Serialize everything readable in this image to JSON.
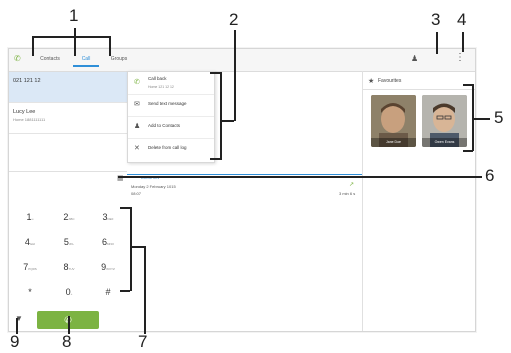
{
  "tabs": [
    {
      "label": "Contacts",
      "active": false
    },
    {
      "label": "Call",
      "active": true
    },
    {
      "label": "Groups",
      "active": false
    }
  ],
  "call_log": [
    {
      "name": "021 121 12",
      "sub": "",
      "time": "3 min ago",
      "selected": true
    },
    {
      "name": "Lucy Lee",
      "sub": "Home 1881111111",
      "time": "27 mins ago",
      "selected": false
    }
  ],
  "menu": {
    "items": [
      {
        "label": "Call back",
        "sub": "Home 121 12 12",
        "icon": "phone-icon"
      },
      {
        "label": "Send text message",
        "sub": "",
        "icon": "message-icon"
      },
      {
        "label": "Add to Contacts",
        "sub": "",
        "icon": "add-contact-icon"
      },
      {
        "label": "Delete from call log",
        "sub": "",
        "icon": "close-icon"
      }
    ]
  },
  "duration": {
    "label": "DURATION",
    "date": "Monday 2 February 1015",
    "time": "08:07",
    "length": "3 min 6 s"
  },
  "keypad": [
    {
      "digit": "1",
      "letters": "••"
    },
    {
      "digit": "2",
      "letters": "ABC"
    },
    {
      "digit": "3",
      "letters": "DEF"
    },
    {
      "digit": "4",
      "letters": "GHI"
    },
    {
      "digit": "5",
      "letters": "JKL"
    },
    {
      "digit": "6",
      "letters": "MNO"
    },
    {
      "digit": "7",
      "letters": "PQRS"
    },
    {
      "digit": "8",
      "letters": "TUV"
    },
    {
      "digit": "9",
      "letters": "WXYZ"
    },
    {
      "digit": "*",
      "letters": ""
    },
    {
      "digit": "0",
      "letters": "+"
    },
    {
      "digit": "#",
      "letters": ""
    }
  ],
  "favourites": {
    "title": "Favourites",
    "people": [
      {
        "name": "Jane Doe"
      },
      {
        "name": "Owen Evans"
      }
    ]
  },
  "callouts": [
    "1",
    "2",
    "3",
    "4",
    "5",
    "6",
    "7",
    "8",
    "9"
  ],
  "colors": {
    "accent": "#2f8fd8",
    "call_green": "#7cb342"
  }
}
